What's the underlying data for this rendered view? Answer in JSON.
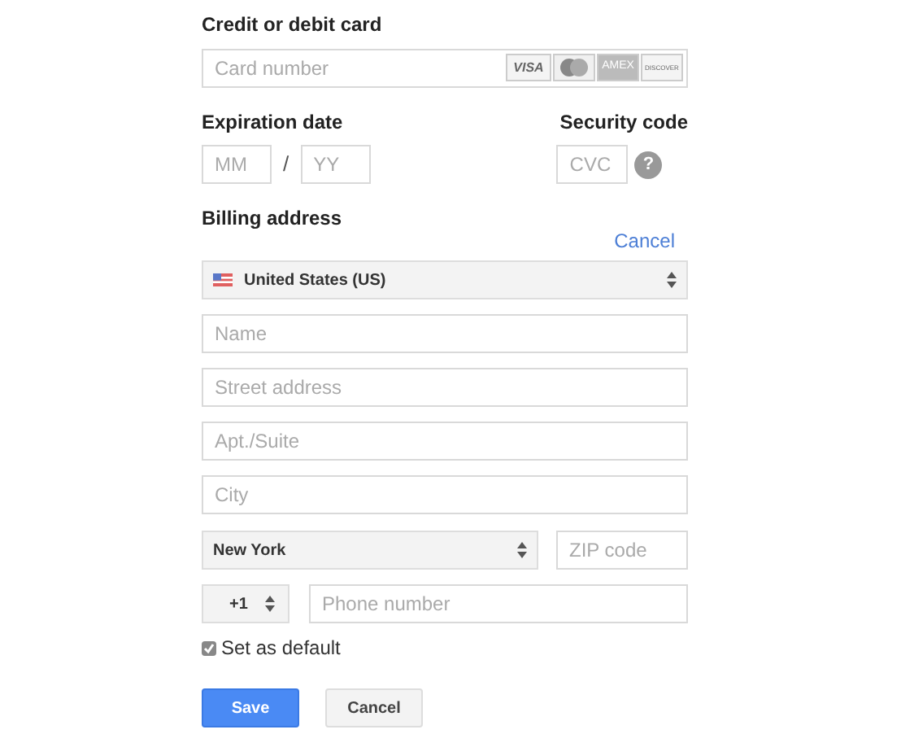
{
  "card": {
    "title": "Credit or debit card",
    "placeholder": "Card number",
    "logos": [
      {
        "kind": "visa",
        "label": "VISA"
      },
      {
        "kind": "mastercard"
      },
      {
        "kind": "amex",
        "label": "AMEX"
      },
      {
        "kind": "discover",
        "label": "DISCOVER"
      }
    ]
  },
  "expiration": {
    "label": "Expiration date",
    "month_placeholder": "MM",
    "separator": "/",
    "year_placeholder": "YY"
  },
  "security": {
    "label": "Security code",
    "placeholder": "CVC",
    "help": "?"
  },
  "billing": {
    "title": "Billing address",
    "cancel_link": "Cancel",
    "country": "United States (US)",
    "fields": [
      {
        "placeholder": "Name"
      },
      {
        "placeholder": "Street address"
      },
      {
        "placeholder": "Apt./Suite"
      },
      {
        "placeholder": "City"
      }
    ],
    "state": "New York",
    "zip_placeholder": "ZIP code",
    "phone_code": "+1",
    "phone_placeholder": "Phone number"
  },
  "default_checkbox": {
    "label": "Set as default",
    "checked": true
  },
  "buttons": [
    {
      "kind": "primary",
      "label": "Save"
    },
    {
      "kind": "secondary",
      "label": "Cancel"
    }
  ]
}
